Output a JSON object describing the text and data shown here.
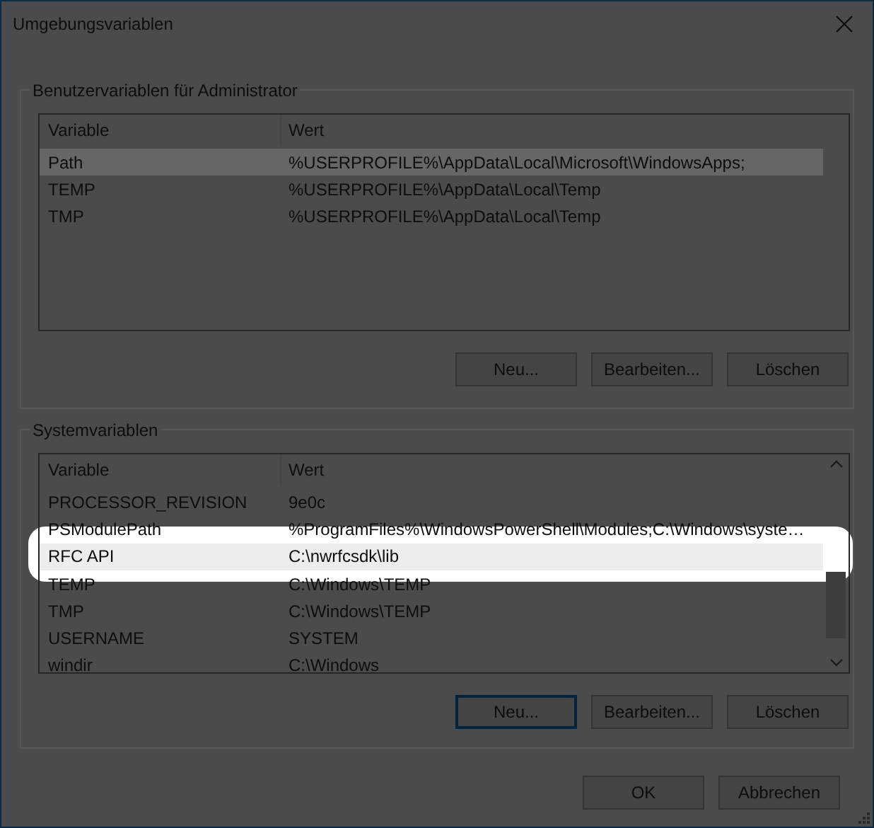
{
  "window": {
    "title": "Umgebungsvariablen"
  },
  "user_variables": {
    "title": "Benutzervariablen für Administrator",
    "columns": [
      "Variable",
      "Wert"
    ],
    "rows": [
      {
        "variable": "Path",
        "value": "%USERPROFILE%\\AppData\\Local\\Microsoft\\WindowsApps;",
        "selected": true
      },
      {
        "variable": "TEMP",
        "value": "%USERPROFILE%\\AppData\\Local\\Temp",
        "selected": false
      },
      {
        "variable": "TMP",
        "value": "%USERPROFILE%\\AppData\\Local\\Temp",
        "selected": false
      }
    ],
    "buttons": [
      {
        "label": "Neu...",
        "focused": false
      },
      {
        "label": "Bearbeiten...",
        "focused": false
      },
      {
        "label": "Löschen",
        "focused": false
      }
    ]
  },
  "system_variables": {
    "title": "Systemvariablen",
    "columns": [
      "Variable",
      "Wert"
    ],
    "rows": [
      {
        "variable": "PROCESSOR_REVISION",
        "value": "9e0c",
        "selected": false,
        "spotlighted": false
      },
      {
        "variable": "PSModulePath",
        "value": "%ProgramFiles%\\WindowsPowerShell\\Modules;C:\\Windows\\syste…",
        "selected": false,
        "spotlighted": false
      },
      {
        "variable": "RFC API",
        "value": "C:\\nwrfcsdk\\lib",
        "selected": true,
        "spotlighted": true
      },
      {
        "variable": "TEMP",
        "value": "C:\\Windows\\TEMP",
        "selected": false,
        "spotlighted": false
      },
      {
        "variable": "TMP",
        "value": "C:\\Windows\\TEMP",
        "selected": false,
        "spotlighted": false
      },
      {
        "variable": "USERNAME",
        "value": "SYSTEM",
        "selected": false,
        "spotlighted": false
      },
      {
        "variable": "windir",
        "value": "C:\\Windows",
        "selected": false,
        "spotlighted": false
      }
    ],
    "buttons": [
      {
        "label": "Neu...",
        "focused": true
      },
      {
        "label": "Bearbeiten...",
        "focused": false
      },
      {
        "label": "Löschen",
        "focused": false
      }
    ]
  },
  "dialog_buttons": [
    "OK",
    "Abbrechen"
  ]
}
